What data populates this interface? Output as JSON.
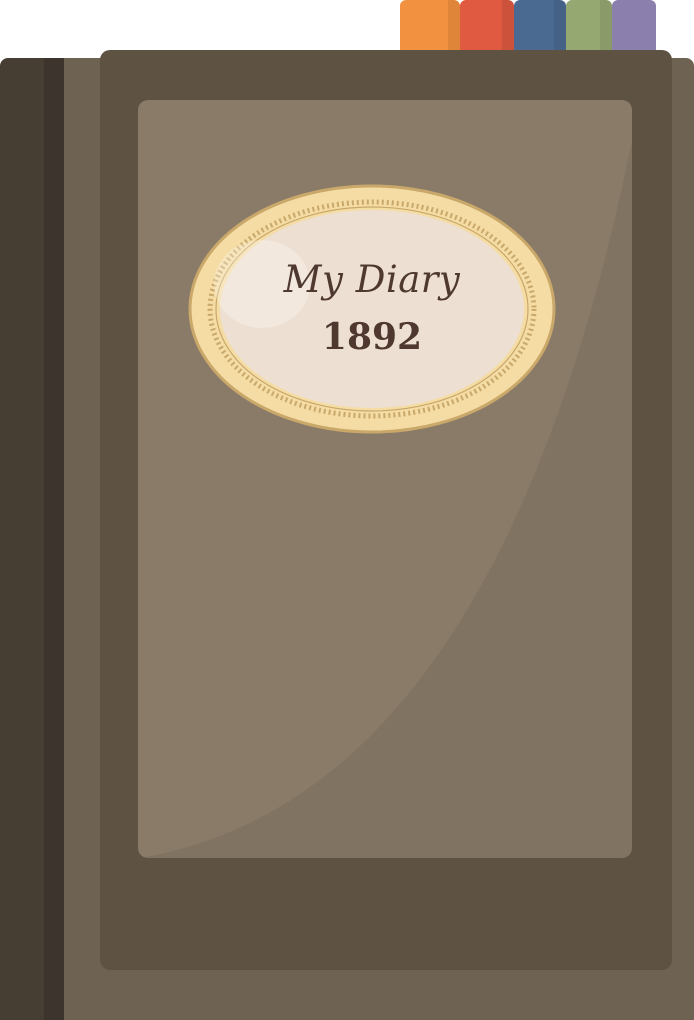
{
  "label": {
    "title": "My Diary",
    "year": "1892"
  },
  "colors": {
    "spine_back": "#463d33",
    "spine_edge": "#3d352d",
    "cover": "#6e6252",
    "cover_frame": "#5e5243",
    "cover_panel": "#8a7b69",
    "label_outer": "#f4dca4",
    "label_inner": "#eddfd1",
    "label_text": "#4e3830",
    "label_border": "#c9a86a",
    "tab_orange": "#f2913f",
    "tab_red": "#df5a41",
    "tab_blue": "#4b6a92",
    "tab_green": "#96a872",
    "tab_purple": "#8a7fad"
  }
}
